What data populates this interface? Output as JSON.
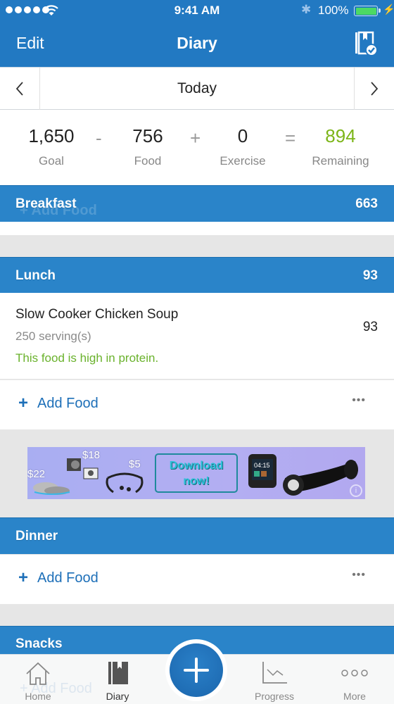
{
  "status_bar": {
    "time": "9:41 AM",
    "battery_percent": "100%",
    "signal_bars": 5,
    "icons": [
      "signal-dots-icon",
      "wifi-icon",
      "bluetooth-icon",
      "battery-icon",
      "charging-bolt-icon"
    ]
  },
  "nav": {
    "edit_label": "Edit",
    "title": "Diary",
    "right_icon": "diary-complete-icon"
  },
  "date_nav": {
    "label": "Today",
    "prev_icon": "chevron-left-icon",
    "next_icon": "chevron-right-icon"
  },
  "summary": {
    "goal": {
      "value": "1,650",
      "label": "Goal"
    },
    "op1": "-",
    "food": {
      "value": "756",
      "label": "Food"
    },
    "op2": "+",
    "exercise": {
      "value": "0",
      "label": "Exercise"
    },
    "op3": "=",
    "remaining": {
      "value": "894",
      "label": "Remaining"
    },
    "remaining_color": "#7cb518"
  },
  "meals": {
    "breakfast": {
      "name": "Breakfast",
      "calories": "663",
      "ghost_add_label": "+ Add Food"
    },
    "lunch": {
      "name": "Lunch",
      "calories": "93",
      "items": [
        {
          "name": "Slow Cooker Chicken Soup",
          "serving": "250 serving(s)",
          "note": "This food is high in protein.",
          "calories": "93"
        }
      ],
      "add_label": "Add Food",
      "more_label": "•••"
    },
    "dinner": {
      "name": "Dinner",
      "add_label": "Add Food",
      "more_label": "•••"
    },
    "snacks": {
      "name": "Snacks",
      "ghost_add_label": "+ Add Food"
    }
  },
  "ad": {
    "prices": [
      "$22",
      "$18",
      "$5"
    ],
    "cta": "Download now!",
    "info_icon": "info-icon"
  },
  "tabbar": {
    "tabs": [
      {
        "label": "Home",
        "icon": "home-icon",
        "active": false
      },
      {
        "label": "Diary",
        "icon": "diary-icon",
        "active": true
      },
      {
        "label": "Progress",
        "icon": "progress-chart-icon",
        "active": false
      },
      {
        "label": "More",
        "icon": "more-dots-icon",
        "active": false
      }
    ],
    "fab_icon": "plus-icon"
  },
  "colors": {
    "primary": "#2279c2",
    "meal_header": "#2a84c9",
    "link": "#1d6fb8",
    "protein_note": "#6ab22c",
    "background": "#e6e6e6"
  }
}
